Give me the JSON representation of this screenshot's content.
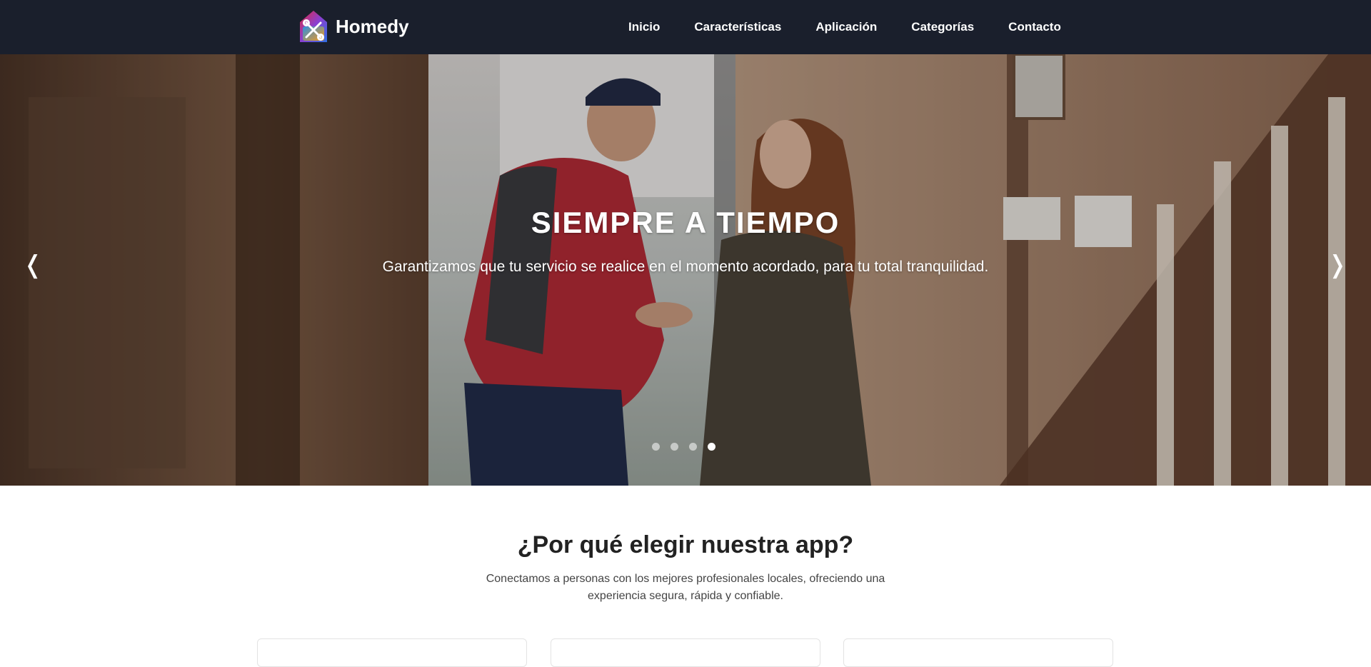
{
  "brand": {
    "name": "Homedy"
  },
  "nav": {
    "items": [
      {
        "label": "Inicio"
      },
      {
        "label": "Características"
      },
      {
        "label": "Aplicación"
      },
      {
        "label": "Categorías"
      },
      {
        "label": "Contacto"
      }
    ]
  },
  "hero": {
    "title": "SIEMPRE A TIEMPO",
    "subtitle": "Garantizamos que tu servicio se realice en el momento acordado, para tu total tranquilidad.",
    "prev_icon": "❬",
    "next_icon": "❭",
    "slide_count": 4,
    "active_slide": 4
  },
  "why": {
    "title": "¿Por qué elegir nuestra app?",
    "description": "Conectamos a personas con los mejores profesionales locales, ofreciendo una experiencia segura, rápida y confiable."
  },
  "colors": {
    "navbar_bg": "#1a1f2c",
    "accent_red": "#e0293d",
    "accent_blue": "#2f6fe0",
    "accent_orange": "#f59a1b"
  }
}
